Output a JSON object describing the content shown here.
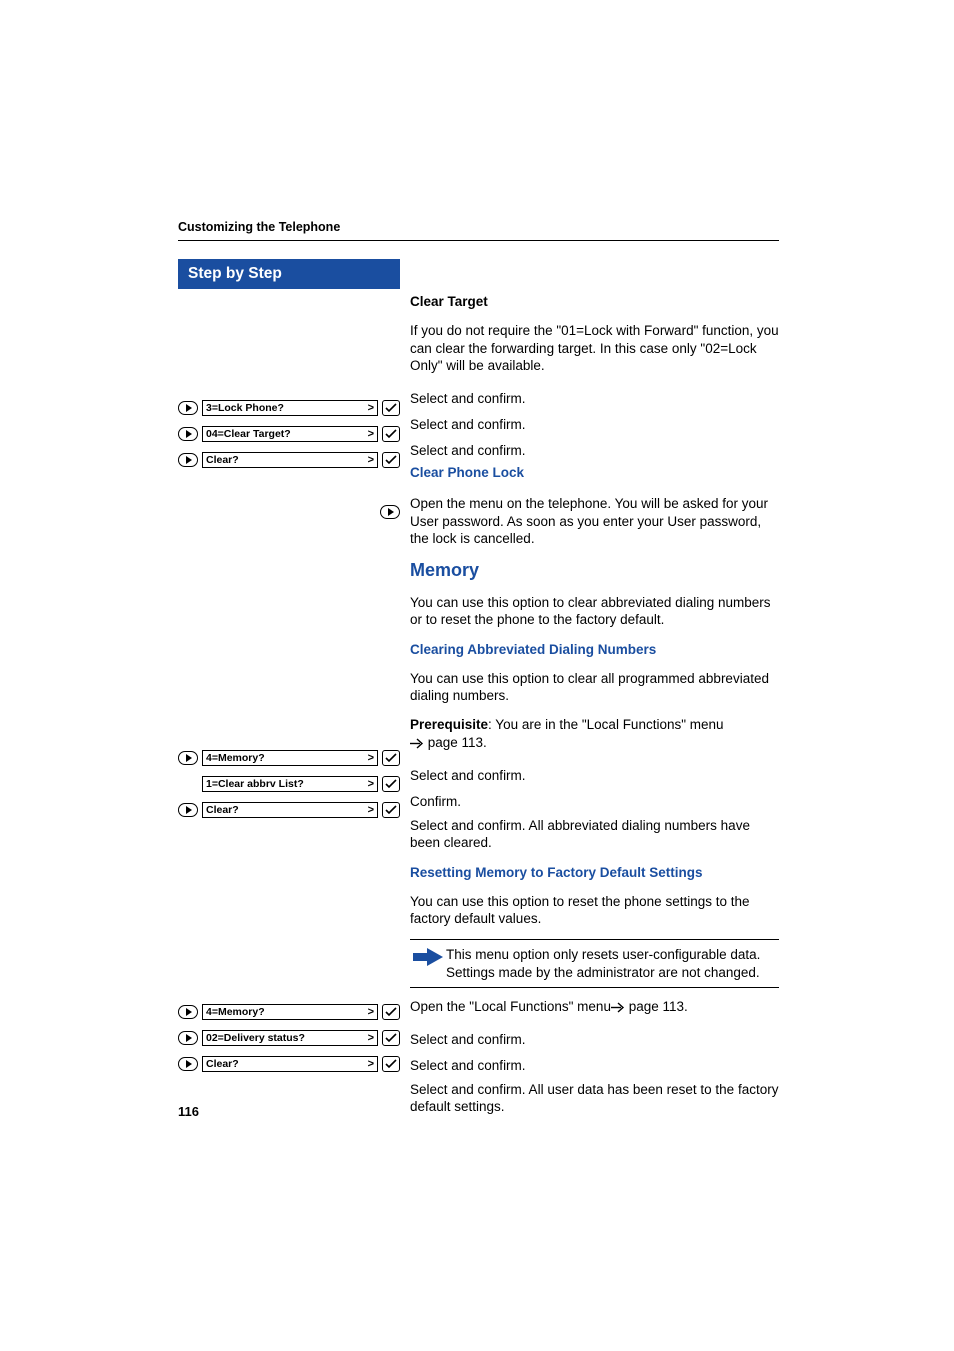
{
  "running_head": "Customizing the Telephone",
  "step_header": "Step by Step",
  "page_number": "116",
  "left": {
    "rows": [
      {
        "type": "nav-display-ok",
        "label": "3=Lock Phone?"
      },
      {
        "type": "nav-display-ok",
        "label": "04=Clear Target?"
      },
      {
        "type": "nav-display-ok",
        "label": "Clear?"
      },
      {
        "type": "nav-only"
      },
      {
        "type": "nav-display-ok",
        "label": "4=Memory?"
      },
      {
        "type": "display-ok",
        "label": "1=Clear abbrv List?"
      },
      {
        "type": "nav-display-ok",
        "label": "Clear?"
      },
      {
        "type": "nav-display-ok",
        "label": "4=Memory?"
      },
      {
        "type": "nav-display-ok",
        "label": "02=Delivery status?"
      },
      {
        "type": "nav-display-ok",
        "label": "Clear?"
      }
    ]
  },
  "right": {
    "clear_target": {
      "heading": "Clear Target",
      "para": "If you do not require the \"01=Lock with Forward\" function, you can clear the forwarding target. In this case only \"02=Lock Only\" will be available.",
      "sc1": "Select and confirm.",
      "sc2": "Select and confirm.",
      "sc3": "Select and confirm."
    },
    "clear_phone_lock": {
      "heading": "Clear Phone Lock",
      "para": "Open the menu on the telephone. You will be asked for your User password. As soon as you enter your User password, the lock is cancelled."
    },
    "memory": {
      "heading": "Memory",
      "intro": "You can use this option to clear abbreviated dialing numbers or to reset the phone to the factory default.",
      "clearing": {
        "heading": "Clearing Abbreviated Dialing Numbers",
        "para": "You can use this option to clear all programmed abbreviated dialing numbers.",
        "prereq_label": "Prerequisite",
        "prereq_rest": ": You are in the \"Local Functions\" menu ",
        "prereq_page": " page 113.",
        "sc1": "Select and confirm.",
        "conf": "Confirm.",
        "sc2": "Select and confirm. All abbreviated dialing numbers have been cleared."
      },
      "reset": {
        "heading": "Resetting Memory to Factory Default Settings",
        "para": "You can use this option to reset the phone settings to the factory default values.",
        "note": "This menu option only resets user-configurable data. Settings made by the administrator are not changed.",
        "open": "Open the \"Local Functions\" menu",
        "open_page": " page 113.",
        "sc1": "Select and confirm.",
        "sc2": "Select and confirm.",
        "sc3": "Select and confirm. All user data has been reset to the factory default settings."
      }
    }
  }
}
